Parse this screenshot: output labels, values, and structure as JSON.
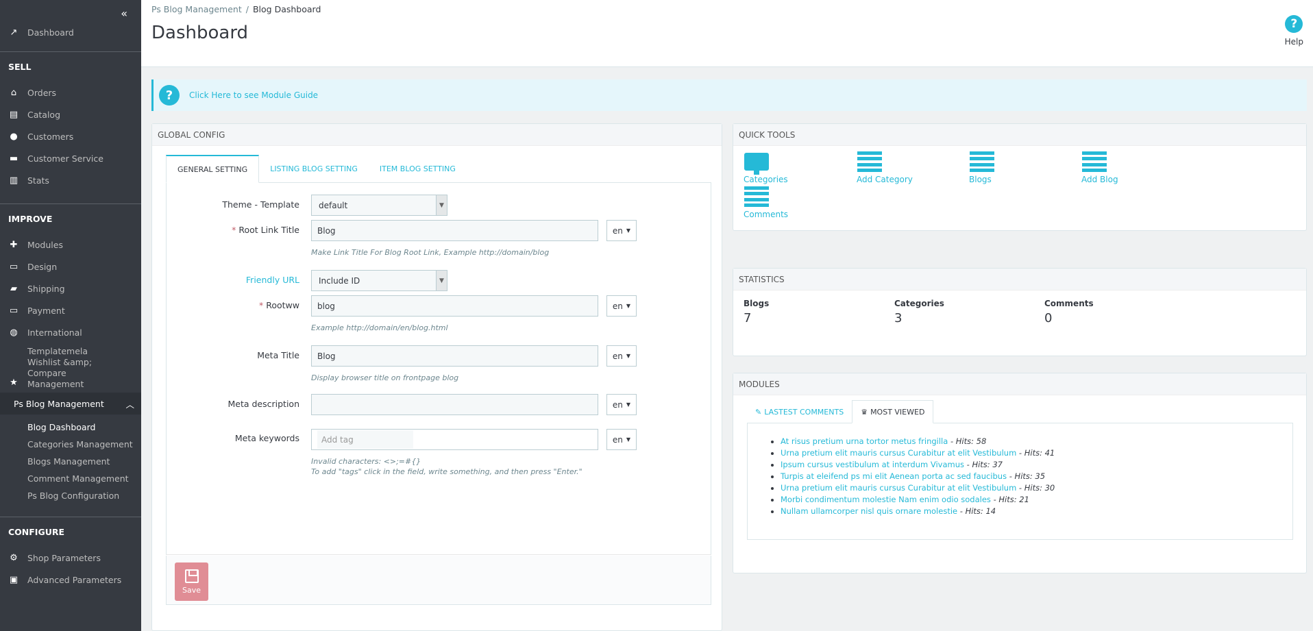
{
  "sidebar": {
    "collapse_icon": "double-chevron-left-icon",
    "dashboard": "Dashboard",
    "sections": {
      "sell": "SELL",
      "improve": "IMPROVE",
      "configure": "CONFIGURE"
    },
    "sell_items": [
      "Orders",
      "Catalog",
      "Customers",
      "Customer Service",
      "Stats"
    ],
    "improve_items": [
      "Modules",
      "Design",
      "Shipping",
      "Payment",
      "International"
    ],
    "templatemela": "Templatemela Wishlist &amp; Compare Management",
    "active_group": "Ps Blog Management",
    "sub_items": [
      "Blog Dashboard",
      "Categories Management",
      "Blogs Management",
      "Comment Management",
      "Ps Blog Configuration"
    ],
    "configure_items": [
      "Shop Parameters",
      "Advanced Parameters"
    ]
  },
  "header": {
    "breadcrumb": [
      "Ps Blog Management",
      "Blog Dashboard"
    ],
    "breadcrumb_sep": "/",
    "title": "Dashboard",
    "help_label": "Help",
    "help_glyph": "?"
  },
  "guide": {
    "glyph": "?",
    "link": "Click Here to see Module Guide"
  },
  "global_config": {
    "heading": "GLOBAL CONFIG",
    "tabs": [
      "GENERAL SETTING",
      "LISTING BLOG SETTING",
      "ITEM BLOG SETTING"
    ],
    "fields": {
      "theme_label": "Theme - Template",
      "theme_value": "default",
      "root_link_label": "Root Link Title",
      "root_link_value": "Blog",
      "root_link_hint": "Make Link Title For Blog Root Link, Example http://domain/blog",
      "friendly_label": "Friendly URL",
      "friendly_value": "Include ID",
      "rootww_label": "Rootww",
      "rootww_value": "blog",
      "rootww_hint": "Example http://domain/en/blog.html",
      "meta_title_label": "Meta Title",
      "meta_title_value": "Blog",
      "meta_title_hint": "Display browser title on frontpage blog",
      "meta_desc_label": "Meta description",
      "meta_desc_value": "",
      "meta_kw_label": "Meta keywords",
      "meta_kw_placeholder": "Add tag",
      "meta_kw_hint1": "Invalid characters: <>;=#{}",
      "meta_kw_hint2": "To add \"tags\" click in the field, write something, and then press \"Enter.\"",
      "lang": "en",
      "required_mark": "*"
    },
    "save_label": "Save"
  },
  "quick_tools": {
    "heading": "QUICK TOOLS",
    "items": [
      "Categories",
      "Add Category",
      "Blogs",
      "Add Blog",
      "Comments"
    ]
  },
  "statistics": {
    "heading": "STATISTICS",
    "items": [
      {
        "label": "Blogs",
        "value": "7"
      },
      {
        "label": "Categories",
        "value": "3"
      },
      {
        "label": "Comments",
        "value": "0"
      }
    ]
  },
  "modules": {
    "heading": "MODULES",
    "tabs": [
      "LASTEST COMMENTS",
      "MOST VIEWED"
    ],
    "most_viewed": [
      {
        "title": "At risus pretium urna tortor metus fringilla",
        "hits": " - Hits: 58"
      },
      {
        "title": "Urna pretium elit mauris cursus Curabitur at elit Vestibulum",
        "hits": " - Hits: 41"
      },
      {
        "title": "Ipsum cursus vestibulum at interdum Vivamus",
        "hits": " - Hits: 37"
      },
      {
        "title": "Turpis at eleifend ps mi elit Aenean porta ac sed faucibus",
        "hits": " - Hits: 35"
      },
      {
        "title": "Urna pretium elit mauris cursus Curabitur at elit Vestibulum",
        "hits": " - Hits: 30"
      },
      {
        "title": "Morbi condimentum molestie Nam enim odio sodales",
        "hits": " - Hits: 21"
      },
      {
        "title": "Nullam ullamcorper nisl quis ornare molestie",
        "hits": " - Hits: 14"
      }
    ]
  },
  "colors": {
    "accent": "#25b9d7",
    "sidebar": "#363a41",
    "save": "#e08d95"
  }
}
